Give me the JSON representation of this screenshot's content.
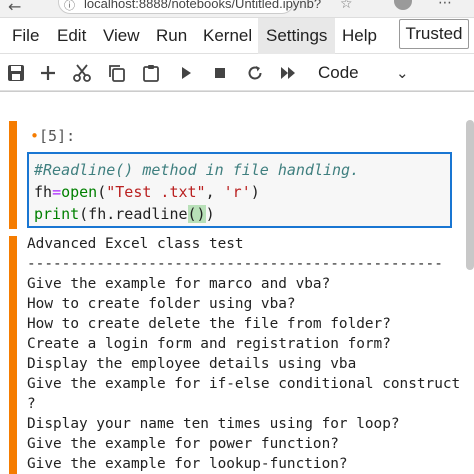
{
  "browser": {
    "url": "localhost:8888/notebooks/Untitled.ipynb?"
  },
  "menu": {
    "items": [
      "File",
      "Edit",
      "View",
      "Run",
      "Kernel",
      "Settings",
      "Help"
    ],
    "trusted_label": "Trusted"
  },
  "toolbar": {
    "cell_type": "Code"
  },
  "cell": {
    "prompt": "[5]:",
    "code": {
      "line1": "#Readline() method in file handling.",
      "line2_var": "fh",
      "line2_op": "=",
      "line2_func": "open",
      "line2_open": "(",
      "line2_arg1": "\"Test .txt\"",
      "line2_sep": ", ",
      "line2_arg2": "'r'",
      "line2_close": ")",
      "line3_func": "print",
      "line3_arg": "(fh.readline",
      "line3_bracket": "()",
      "line3_close": ")"
    },
    "output": [
      "Advanced Excel class test",
      "------------------------------------------------",
      "Give the example for marco and vba?",
      "How to create folder using vba?",
      "How to create delete the file from folder?",
      "Create a login form and registration form?",
      "Display the employee details using vba",
      "Give the example for if-else conditional construct",
      "?",
      "Display your name ten times using for loop?",
      "Give the example for power function?",
      "Give the example for lookup-function?"
    ]
  },
  "colors": {
    "accent": "#f57c00",
    "editor_border": "#1976d2"
  }
}
